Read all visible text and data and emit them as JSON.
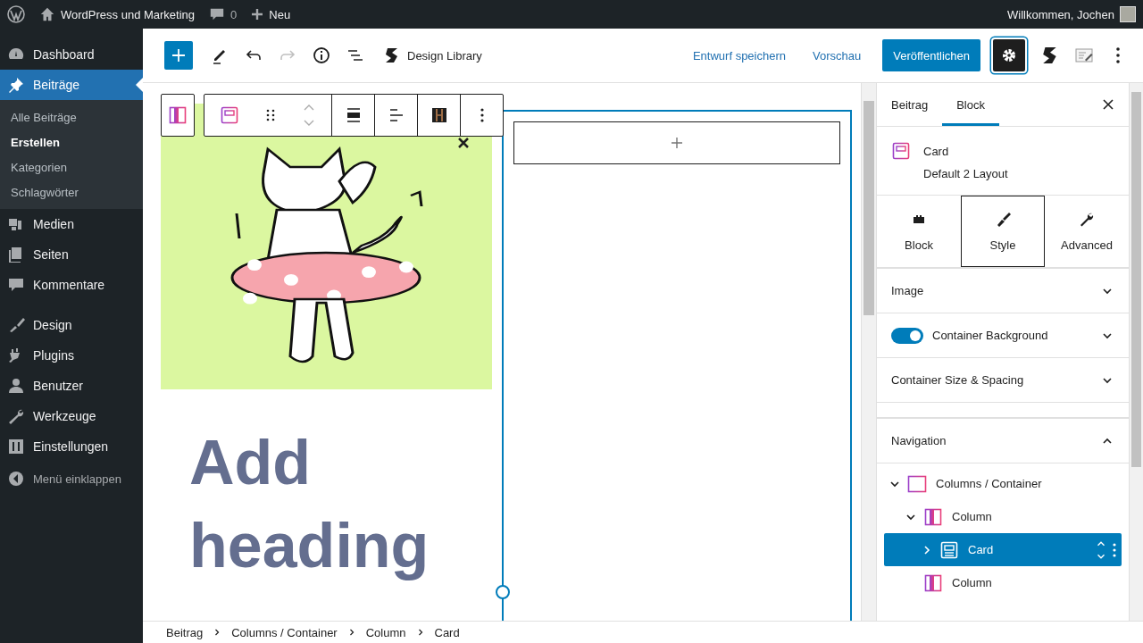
{
  "admin_bar": {
    "site_title": "WordPress und Marketing",
    "comments": "0",
    "new_label": "Neu",
    "greeting": "Willkommen, Jochen"
  },
  "admin_menu": {
    "items": [
      {
        "label": "Dashboard",
        "selected": false
      },
      {
        "label": "Beiträge",
        "selected": true,
        "submenu": [
          {
            "label": "Alle Beiträge",
            "selected": false
          },
          {
            "label": "Erstellen",
            "selected": true
          },
          {
            "label": "Kategorien",
            "selected": false
          },
          {
            "label": "Schlagwörter",
            "selected": false
          }
        ]
      },
      {
        "label": "Medien",
        "selected": false
      },
      {
        "label": "Seiten",
        "selected": false
      },
      {
        "label": "Kommentare",
        "selected": false
      },
      {
        "label": "Design",
        "selected": false
      },
      {
        "label": "Plugins",
        "selected": false
      },
      {
        "label": "Benutzer",
        "selected": false
      },
      {
        "label": "Werkzeuge",
        "selected": false
      },
      {
        "label": "Einstellungen",
        "selected": false
      }
    ],
    "collapse_label": "Menü einklappen"
  },
  "editor_header": {
    "design_library": "Design Library",
    "save_draft": "Entwurf speichern",
    "preview": "Vorschau",
    "publish": "Veröffentlichen",
    "settings_pressed": true
  },
  "canvas": {
    "heading": "Add heading"
  },
  "settings_sidebar": {
    "tabs": [
      {
        "label": "Beitrag",
        "selected": false
      },
      {
        "label": "Block",
        "selected": true
      }
    ],
    "block_card": {
      "title": "Card",
      "description": "Default 2 Layout"
    },
    "inspector_tabs": [
      {
        "label": "Block",
        "selected": false
      },
      {
        "label": "Style",
        "selected": true
      },
      {
        "label": "Advanced",
        "selected": false
      }
    ],
    "panels": [
      {
        "title": "Image",
        "kind": "plain",
        "expanded": false
      },
      {
        "title": "Container Background",
        "kind": "toggle",
        "on": true,
        "expanded": false
      },
      {
        "title": "Container Size & Spacing",
        "kind": "plain",
        "expanded": false
      },
      {
        "title": "Navigation",
        "kind": "navigation",
        "expanded": true,
        "tree": [
          {
            "label": "Columns / Container",
            "kind": "columns",
            "selected": false,
            "expanded": true,
            "children": [
              {
                "label": "Column",
                "kind": "column",
                "selected": false,
                "expanded": true,
                "children": [
                  {
                    "label": "Card",
                    "kind": "card",
                    "selected": true,
                    "expanded": false
                  }
                ]
              },
              {
                "label": "Column",
                "kind": "column",
                "selected": false
              }
            ]
          }
        ]
      }
    ]
  },
  "breadcrumb": [
    "Beitrag",
    "Columns / Container",
    "Column",
    "Card"
  ]
}
